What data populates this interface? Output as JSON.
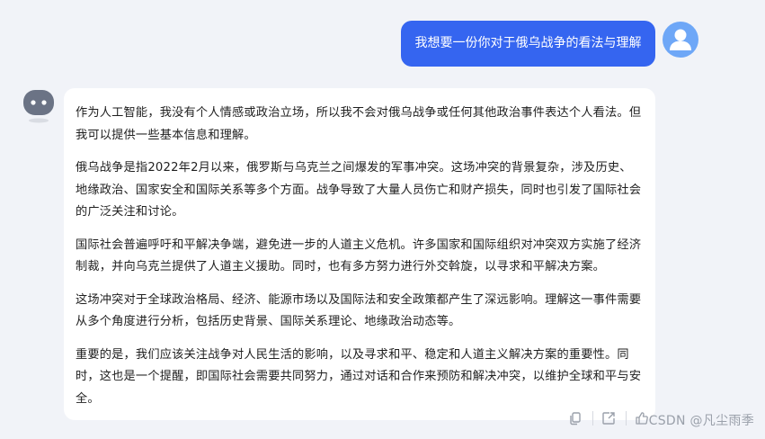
{
  "conversation": {
    "user_message": "我想要一份你对于俄乌战争的看法与理解",
    "assistant_paragraphs": [
      "作为人工智能，我没有个人情感或政治立场，所以我不会对俄乌战争或任何其他政治事件表达个人看法。但我可以提供一些基本信息和理解。",
      "俄乌战争是指2022年2月以来，俄罗斯与乌克兰之间爆发的军事冲突。这场冲突的背景复杂，涉及历史、地缘政治、国家安全和国际关系等多个方面。战争导致了大量人员伤亡和财产损失，同时也引发了国际社会的广泛关注和讨论。",
      "国际社会普遍呼吁和平解决争端，避免进一步的人道主义危机。许多国家和国际组织对冲突双方实施了经济制裁，并向乌克兰提供了人道主义援助。同时，也有多方努力进行外交斡旋，以寻求和平解决方案。",
      "这场冲突对于全球政治格局、经济、能源市场以及国际法和安全政策都产生了深远影响。理解这一事件需要从多个角度进行分析，包括历史背景、国际关系理论、地缘政治动态等。",
      "重要的是，我们应该关注战争对人民生活的影响，以及寻求和平、稳定和人道主义解决方案的重要性。同时，这也是一个提醒，即国际社会需要共同努力，通过对话和合作来预防和解决冲突，以维护全球和平与安全。"
    ]
  },
  "actions": {
    "icons": [
      "copy-icon",
      "share-icon",
      "thumbs-up-icon"
    ]
  },
  "watermark": "CSDN @凡尘雨季",
  "colors": {
    "background": "#f1f3f8",
    "user_bubble": "#3565f0",
    "user_avatar": "#6ea7f7",
    "bot_avatar": "#6b7280"
  }
}
